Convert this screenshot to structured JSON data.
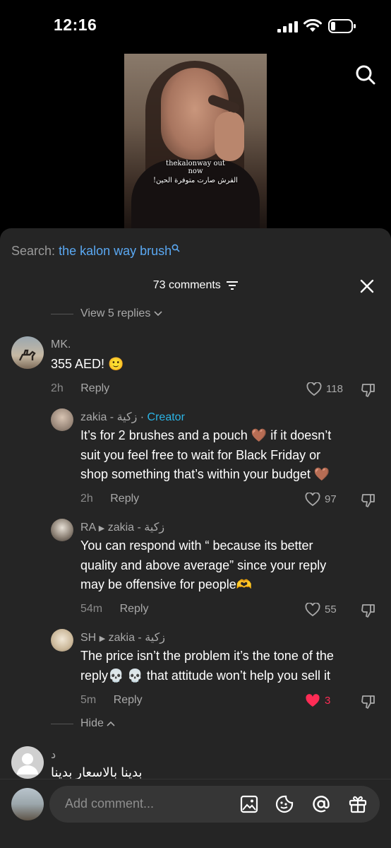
{
  "status_bar": {
    "time": "12:16",
    "battery_level": 0.15
  },
  "video": {
    "caption_line1": "thekalonway out",
    "caption_line2": "now",
    "caption_line3": "الفرش صارت متوفرة الحين!"
  },
  "search": {
    "prefix": "Search:",
    "query": "the kalon way brush"
  },
  "comments_header": {
    "count_label": "73 comments"
  },
  "view_replies": {
    "label": "View 5 replies"
  },
  "comments": [
    {
      "author": "MK.",
      "text": "355 AED! 🙂",
      "time": "2h",
      "reply_label": "Reply",
      "likes": "118",
      "liked": false
    }
  ],
  "replies": [
    {
      "author": "zakia - زكية",
      "badge": "Creator",
      "lines": [
        "It’s for 2 brushes and a pouch 🤎 if it doesn’t",
        "suit you feel free to wait for Black Friday or",
        "shop something that’s within your budget 🤎"
      ],
      "time": "2h",
      "reply_label": "Reply",
      "likes": "97",
      "liked": false
    },
    {
      "author": "RA",
      "reply_to": "zakia - زكية",
      "lines": [
        "You can respond with “ because its better",
        "quality and above average” since your reply",
        "may be offensive for people🫶"
      ],
      "time": "54m",
      "reply_label": "Reply",
      "likes": "55",
      "liked": false
    },
    {
      "author": "SH",
      "reply_to": "zakia - زكية",
      "lines": [
        "The price isn’t the problem it’s the tone of the",
        "reply💀 💀  that attitude won’t help you sell it"
      ],
      "time": "5m",
      "reply_label": "Reply",
      "likes": "3",
      "liked": true
    }
  ],
  "hide": {
    "label": "Hide"
  },
  "last_comment": {
    "author": "د",
    "text": "بدينا بالاسعار بدينا"
  },
  "composer": {
    "placeholder": "Add comment..."
  },
  "colors": {
    "accent_link": "#5aa8f2",
    "creator": "#2bb5e6",
    "liked_heart": "#fe2c55",
    "sheet_bg": "#252525"
  },
  "icons": [
    "search-icon",
    "filter-icon",
    "close-icon",
    "heart-icon",
    "dislike-icon",
    "image-icon",
    "emoji-icon",
    "mention-icon",
    "gift-icon"
  ]
}
